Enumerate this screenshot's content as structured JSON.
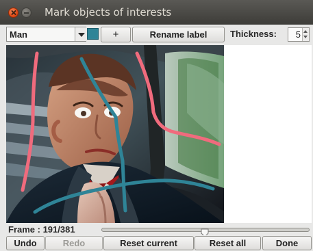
{
  "window": {
    "title": "Mark objects of interests"
  },
  "toolbar": {
    "label_select": "Man",
    "label_color": "#2f8497",
    "add_label_button": "+",
    "rename_label_button": "Rename label",
    "thickness_label": "Thickness:",
    "thickness_value": "5"
  },
  "frame": {
    "label": "Frame : 191/381",
    "current": 191,
    "total": 381
  },
  "actions": {
    "undo": "Undo",
    "redo": "Redo",
    "reset_current": "Reset current",
    "reset_all": "Reset all",
    "done": "Done"
  },
  "colors": {
    "pink_annotation": "#f06b7d",
    "teal_annotation": "#2f8497",
    "window_background": "#e8e8e7"
  },
  "icons": {
    "close": "close-icon",
    "minimize": "minimize-icon",
    "dropdown": "chevron-down-icon",
    "spinner_up": "caret-up-icon",
    "spinner_down": "caret-down-icon"
  }
}
